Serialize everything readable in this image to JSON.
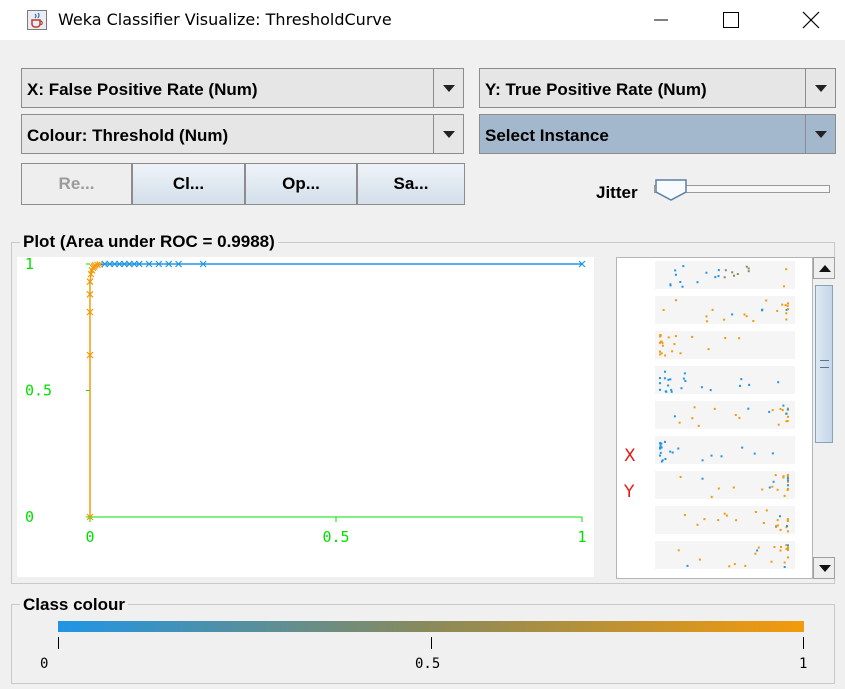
{
  "window": {
    "title": "Weka Classifier Visualize: ThresholdCurve",
    "icon": "java-cup-icon",
    "controls": [
      "minimize-icon",
      "maximize-icon",
      "close-icon"
    ]
  },
  "axes_selectors": {
    "x": "X: False Positive Rate (Num)",
    "y": "Y: True Positive Rate (Num)",
    "colour": "Colour: Threshold (Num)",
    "instance": "Select Instance"
  },
  "buttons": {
    "reset": "Re...",
    "clear": "Cl...",
    "open": "Op...",
    "save": "Sa..."
  },
  "jitter": {
    "label": "Jitter",
    "value": 0
  },
  "plot_panel": {
    "title": "Plot (Area under ROC = 0.9988)"
  },
  "chart_data": {
    "type": "line",
    "x_ticks": [
      "0",
      "0.5",
      "1"
    ],
    "y_ticks": [
      "1",
      "0.5",
      "0"
    ],
    "xlim": [
      0,
      1
    ],
    "ylim": [
      0,
      1
    ],
    "series": [
      {
        "x": [
          0,
          0,
          0,
          0,
          0,
          0.002,
          0.004,
          0.006,
          0.008,
          0.01,
          0.015,
          0.02,
          0.03,
          0.04,
          0.05,
          0.06,
          0.07,
          0.08,
          0.09,
          0.1,
          0.12,
          0.14,
          0.16,
          0.18,
          0.23,
          1
        ],
        "y": [
          0,
          0.64,
          0.81,
          0.88,
          0.93,
          0.96,
          0.975,
          0.985,
          0.99,
          0.995,
          0.997,
          0.998,
          1,
          1,
          1,
          1,
          1,
          1,
          1,
          1,
          1,
          1,
          1,
          1,
          1,
          1
        ]
      }
    ],
    "colour_scale": {
      "low": "#2095e5",
      "mid": "#8a8a5a",
      "high": "#f39a0c"
    }
  },
  "matrix": {
    "x_label": "X",
    "y_label": "Y",
    "scroll_position": 0.1
  },
  "class_colour": {
    "title": "Class colour",
    "ticks": [
      "0",
      "0.5",
      "1"
    ],
    "gradient": [
      "#2095e5",
      "#f39a0c"
    ]
  }
}
